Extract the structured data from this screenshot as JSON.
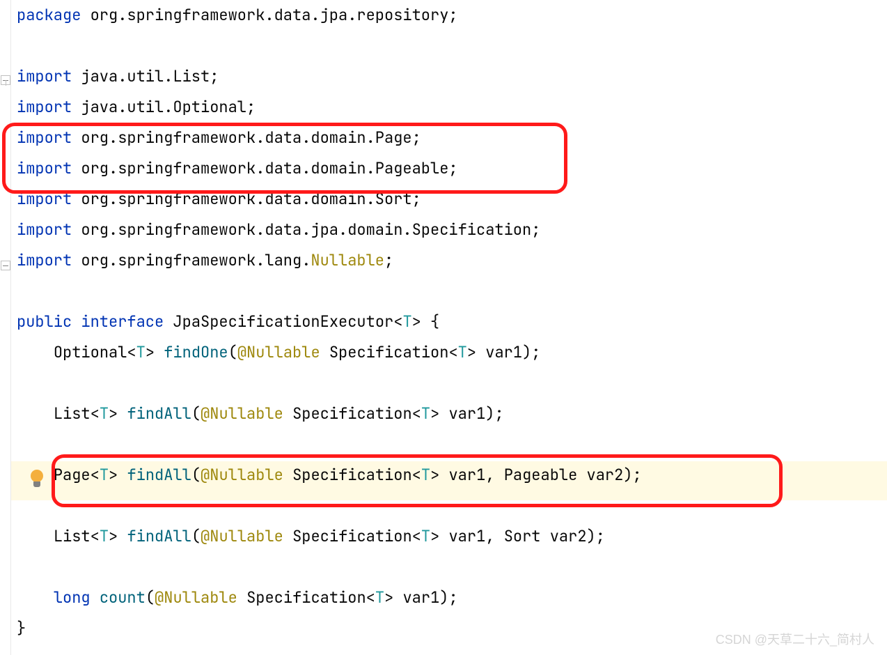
{
  "code": {
    "line1": {
      "kw": "package",
      "rest": " org.springframework.data.jpa.repository;"
    },
    "line3": {
      "kw": "import",
      "rest": " java.util.List;"
    },
    "line4": {
      "kw": "import",
      "rest": " java.util.Optional;"
    },
    "line5": {
      "kw": "import",
      "rest": " org.springframework.data.domain.Page;"
    },
    "line6": {
      "kw": "import",
      "rest": " org.springframework.data.domain.Pageable;"
    },
    "line7": {
      "kw": "import",
      "rest": " org.springframework.data.domain.Sort;"
    },
    "line8": {
      "kw": "import",
      "rest": " org.springframework.data.jpa.domain.Specification;"
    },
    "line9": {
      "kw": "import",
      "p1": " org.springframework.lang.",
      "ann": "Nullable",
      "p2": ";"
    },
    "line11": {
      "kw1": "public",
      "sp1": " ",
      "kw2": "interface",
      "sp2": " ",
      "name": "JpaSpecificationExecutor",
      "lt": "<",
      "gen": "T",
      "gt": ">",
      "brace": " {"
    },
    "line12": {
      "indent": "    ",
      "t1": "Optional",
      "lt1": "<",
      "g1": "T",
      "gt1": "> ",
      "m": "findOne",
      "p1": "(",
      "at": "@Nullable",
      "sp": " ",
      "t2": "Specification",
      "lt2": "<",
      "g2": "T",
      "gt2": "> ",
      "v": "var1",
      "p2": ");"
    },
    "line14": {
      "indent": "    ",
      "t1": "List",
      "lt1": "<",
      "g1": "T",
      "gt1": "> ",
      "m": "findAll",
      "p1": "(",
      "at": "@Nullable",
      "sp": " ",
      "t2": "Specification",
      "lt2": "<",
      "g2": "T",
      "gt2": "> ",
      "v": "var1",
      "p2": ");"
    },
    "line16": {
      "indent": "    ",
      "t1": "Page",
      "lt1": "<",
      "g1": "T",
      "gt1": "> ",
      "m": "findAll",
      "p1": "(",
      "at": "@Nullable",
      "sp": " ",
      "t2": "Specification",
      "lt2": "<",
      "g2": "T",
      "gt2": "> ",
      "v1": "var1",
      "c": ", ",
      "t3": "Pageable ",
      "v2": "var2",
      "p2": ");"
    },
    "line18": {
      "indent": "    ",
      "t1": "List",
      "lt1": "<",
      "g1": "T",
      "gt1": "> ",
      "m": "findAll",
      "p1": "(",
      "at": "@Nullable",
      "sp": " ",
      "t2": "Specification",
      "lt2": "<",
      "g2": "T",
      "gt2": "> ",
      "v1": "var1",
      "c": ", ",
      "t3": "Sort ",
      "v2": "var2",
      "p2": ");"
    },
    "line20": {
      "indent": "    ",
      "kw": "long",
      "sp": " ",
      "m": "count",
      "p1": "(",
      "at": "@Nullable",
      "sp2": " ",
      "t2": "Specification",
      "lt2": "<",
      "g2": "T",
      "gt2": "> ",
      "v": "var1",
      "p2": ");"
    },
    "line21": {
      "brace": "}"
    }
  },
  "watermark": "CSDN @天草二十六_简村人"
}
